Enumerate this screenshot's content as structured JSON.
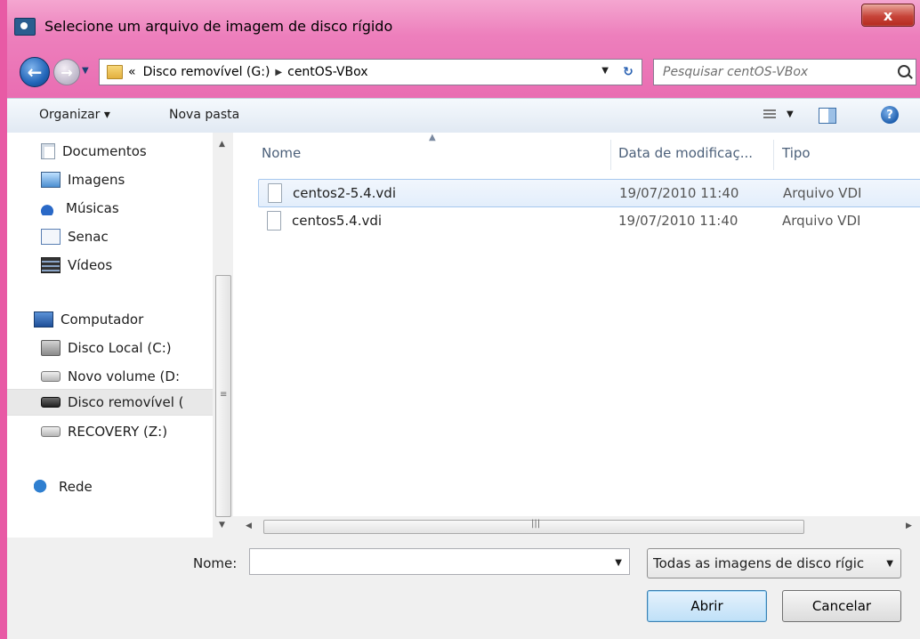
{
  "window": {
    "title": "Selecione um arquivo de imagem de disco rígido",
    "close_label": "x"
  },
  "address": {
    "prefix": "«",
    "crumbs": [
      "Disco removível (G:)",
      "centOS-VBox"
    ],
    "search_placeholder": "Pesquisar centOS-VBox"
  },
  "toolbar": {
    "organize_label": "Organizar ▾",
    "new_folder_label": "Nova pasta",
    "help_label": "?"
  },
  "nav": {
    "items": [
      {
        "label": "Documentos",
        "icon": "documents-icon"
      },
      {
        "label": "Imagens",
        "icon": "pictures-icon"
      },
      {
        "label": "Músicas",
        "icon": "music-icon"
      },
      {
        "label": "Senac",
        "icon": "library-icon"
      },
      {
        "label": "Vídeos",
        "icon": "videos-icon"
      },
      {
        "label": "Computador",
        "icon": "computer-icon"
      },
      {
        "label": "Disco Local (C:)",
        "icon": "local-disk-icon"
      },
      {
        "label": "Novo volume (D:",
        "icon": "drive-icon"
      },
      {
        "label": "Disco removível (",
        "icon": "removable-drive-icon",
        "selected": true
      },
      {
        "label": "RECOVERY (Z:)",
        "icon": "drive-icon"
      },
      {
        "label": "Rede",
        "icon": "network-icon"
      }
    ]
  },
  "filelist": {
    "columns": [
      "Nome",
      "Data de modificaç...",
      "Tipo"
    ],
    "rows": [
      {
        "name": "centos2-5.4.vdi",
        "date": "19/07/2010 11:40",
        "type": "Arquivo VDI",
        "selected": true
      },
      {
        "name": "centos5.4.vdi",
        "date": "19/07/2010 11:40",
        "type": "Arquivo VDI"
      }
    ]
  },
  "footer": {
    "name_label": "Nome:",
    "name_value": "",
    "filter_value": "Todas as imagens de disco rígic",
    "open_label": "Abrir",
    "cancel_label": "Cancelar"
  },
  "colors": {
    "frame": "#e96db2",
    "selection_border": "#a6c7ee",
    "header_text": "#4c607a"
  }
}
